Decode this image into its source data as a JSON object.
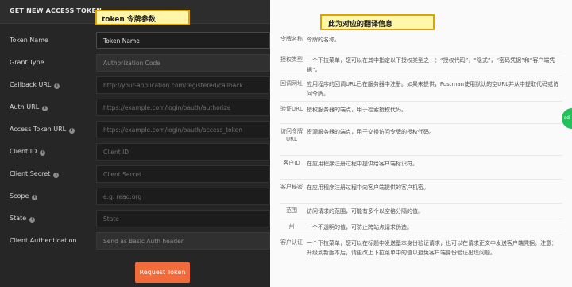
{
  "modal": {
    "title": "GET NEW ACCESS TOKEN",
    "close": "✕",
    "fields": [
      {
        "label": "Token Name",
        "value": "Token Name",
        "info": false,
        "kind": "filled"
      },
      {
        "label": "Grant Type",
        "value": "Authorization Code",
        "info": false,
        "kind": "select"
      },
      {
        "label": "Callback URL",
        "value": "http://your-application.com/registered/callback",
        "info": true,
        "kind": "placeholder"
      },
      {
        "label": "Auth URL",
        "value": "https://example.com/login/oauth/authorize",
        "info": true,
        "kind": "placeholder"
      },
      {
        "label": "Access Token URL",
        "value": "https://example.com/login/oauth/access_token",
        "info": true,
        "kind": "placeholder"
      },
      {
        "label": "Client ID",
        "value": "Client ID",
        "info": true,
        "kind": "placeholder"
      },
      {
        "label": "Client Secret",
        "value": "Client Secret",
        "info": true,
        "kind": "placeholder"
      },
      {
        "label": "Scope",
        "value": "e.g. read:org",
        "info": true,
        "kind": "placeholder"
      },
      {
        "label": "State",
        "value": "State",
        "info": true,
        "kind": "placeholder"
      },
      {
        "label": "Client Authentication",
        "value": "Send as Basic Auth header",
        "info": false,
        "kind": "select"
      }
    ],
    "button": "Request Token"
  },
  "callouts": {
    "left": "token 令牌参数",
    "right": "此为对应的翻译信息"
  },
  "translations": [
    {
      "key": "令牌名称",
      "text": "令牌的名称。"
    },
    {
      "key": "授权类型",
      "text": "一个下拉菜单，您可以在其中指定以下授权类型之一：“授权代码”，“隐式”，“密码凭据”和“客户端凭据”。"
    },
    {
      "key": "回调网址",
      "text": "应用程序的回调URL已在服务器中注册。如果未提供，Postman使用默认的空URL并从中提取代码或访问令牌。"
    },
    {
      "key": "验证URL",
      "text": "授权服务器的端点，用于检索授权代码。"
    },
    {
      "key": "访问令牌URL",
      "text": "资源服务器的端点，用于交换访问令牌的授权代码。"
    },
    {
      "key": "客户ID",
      "text": "在应用程序注册过程中提供给客户端标识符。"
    },
    {
      "key": "客户秘密",
      "text": "在应用程序注册过程中向客户端提供的客户机密。"
    },
    {
      "key": "范围",
      "text": "访问请求的范围，可能有多个以空格分隔的值。"
    },
    {
      "key": "州",
      "text": "一个不透明的值，可防止跨站点请求伪造。"
    },
    {
      "key": "客户认证",
      "text": "一个下拉菜单，您可以在标题中发送基本身份验证请求，也可以在请求正文中发送客户端凭据。注意：升级到新版本后，请更改上下拉菜单中的值以避免客户端身份验证出现问题。"
    }
  ],
  "side_badge": "sdi"
}
